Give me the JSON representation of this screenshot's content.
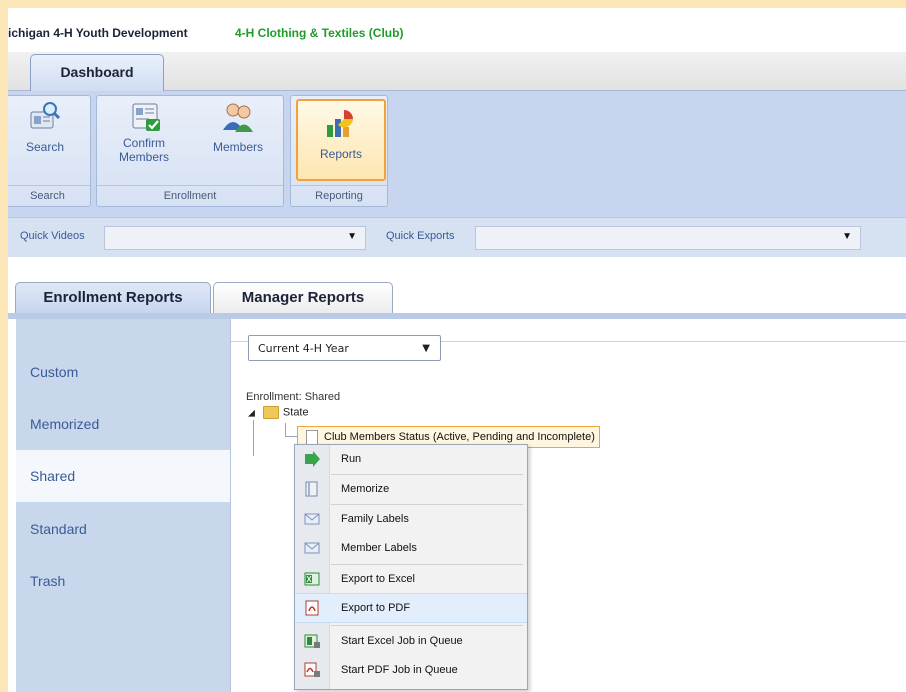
{
  "header": {
    "org": "ichigan 4-H Youth Development",
    "club": "4-H Clothing & Textiles (Club)"
  },
  "main_tab": "Dashboard",
  "ribbon": {
    "groups": [
      {
        "label": "Search",
        "buttons": [
          {
            "label": "Search",
            "icon": "search-user-icon"
          }
        ]
      },
      {
        "label": "Enrollment",
        "buttons": [
          {
            "label": "Confirm Members",
            "icon": "confirm-members-icon"
          },
          {
            "label": "Members",
            "icon": "members-icon"
          }
        ]
      },
      {
        "label": "Reporting",
        "buttons": [
          {
            "label": "Reports",
            "icon": "pie-chart-icon"
          }
        ]
      }
    ]
  },
  "quickbar": {
    "videos_label": "Quick Videos",
    "videos_value": "",
    "exports_label": "Quick Exports",
    "exports_value": ""
  },
  "report_tabs": [
    "Enrollment Reports",
    "Manager Reports"
  ],
  "sidebar": {
    "items": [
      "Custom",
      "Memorized",
      "Shared",
      "Standard",
      "Trash"
    ],
    "selected": "Shared"
  },
  "content": {
    "year_select": "Current 4-H Year",
    "enrollment_label": "Enrollment: Shared",
    "tree_root": "State",
    "report_name": "Club Members Status (Active, Pending and Incomplete)"
  },
  "context_menu": {
    "items": [
      {
        "label": "Run",
        "icon": "run-arrow-icon"
      },
      {
        "label": "Memorize",
        "icon": "memorize-icon"
      },
      {
        "label": "Family Labels",
        "icon": "envelope-icon"
      },
      {
        "label": "Member Labels",
        "icon": "envelope-icon"
      },
      {
        "label": "Export to Excel",
        "icon": "excel-icon"
      },
      {
        "label": "Export to PDF",
        "icon": "pdf-icon"
      },
      {
        "label": "Start Excel Job in Queue",
        "icon": "excel-queue-icon"
      },
      {
        "label": "Start PDF Job in Queue",
        "icon": "pdf-queue-icon"
      }
    ],
    "highlighted": "Export to PDF"
  }
}
